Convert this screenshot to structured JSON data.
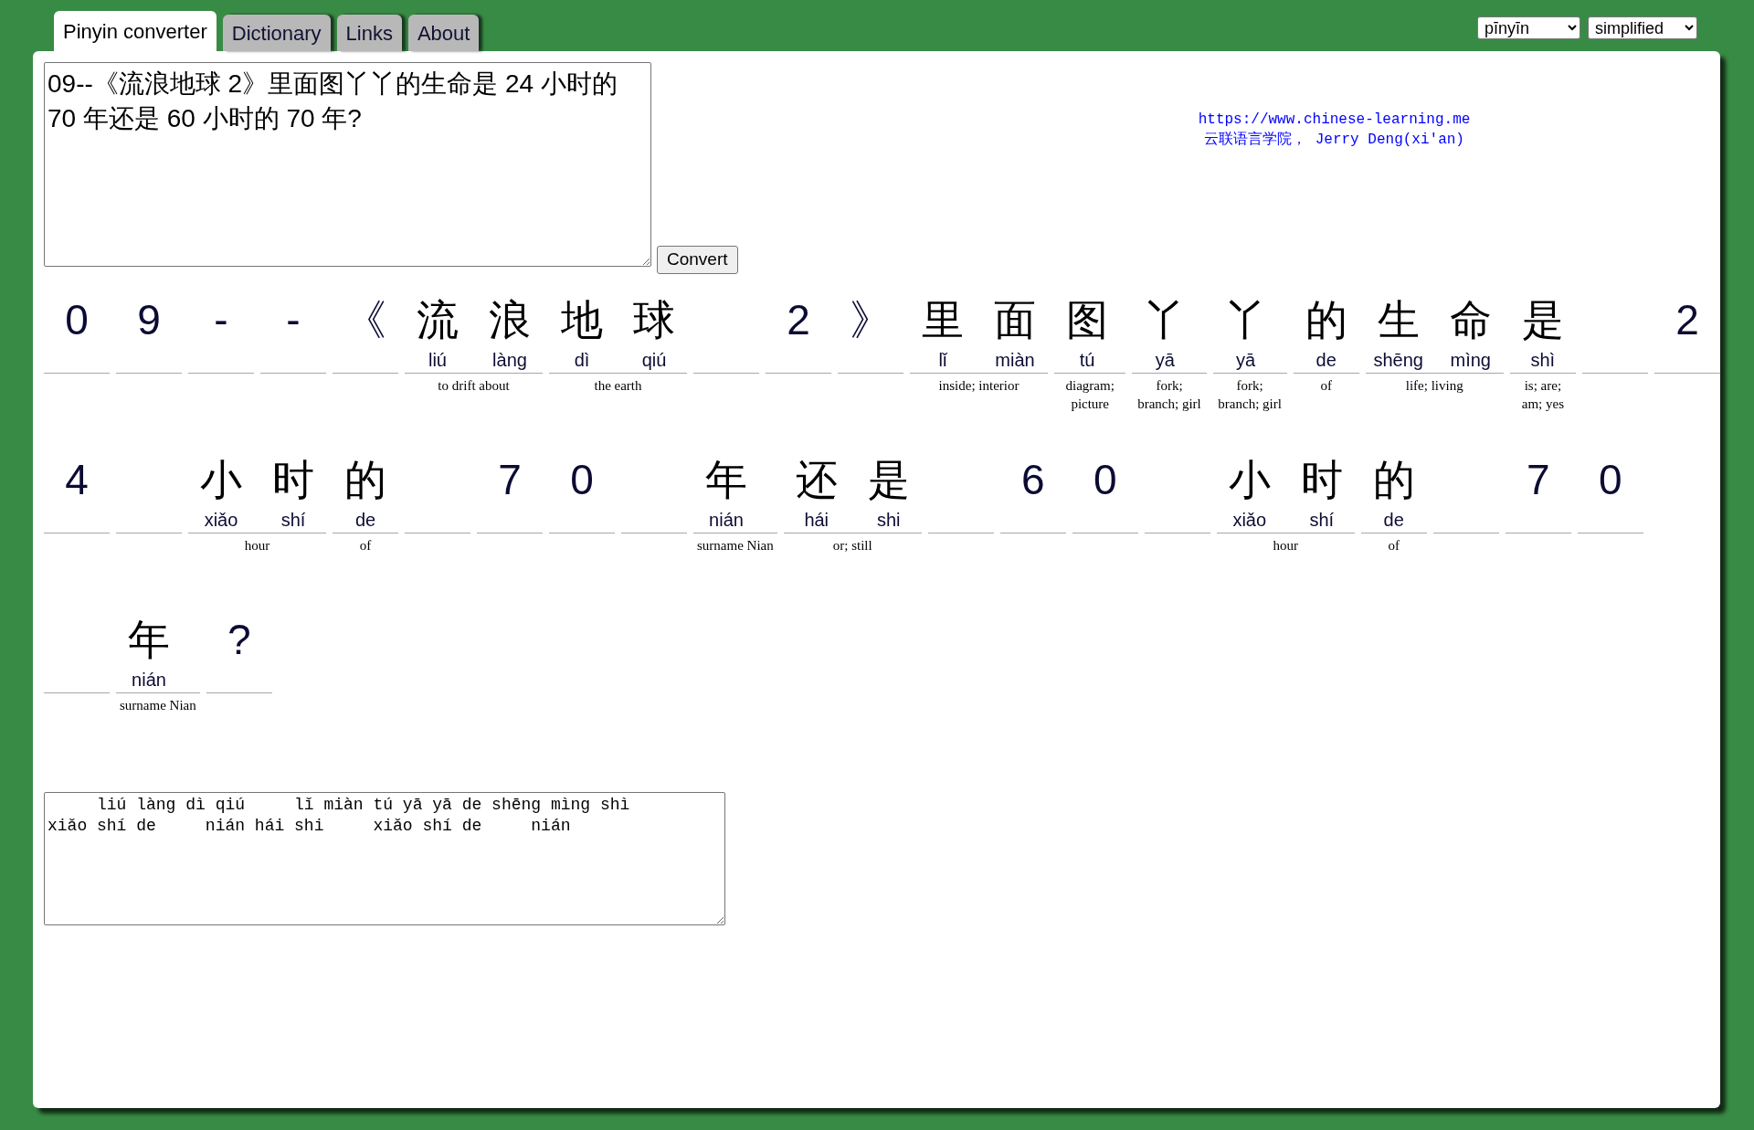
{
  "tabs": [
    {
      "label": "Pinyin converter",
      "selected": true
    },
    {
      "label": "Dictionary",
      "selected": false
    },
    {
      "label": "Links",
      "selected": false
    },
    {
      "label": "About",
      "selected": false
    }
  ],
  "selects": [
    {
      "value": "pīnyīn"
    },
    {
      "value": "simplified"
    }
  ],
  "input": {
    "value": "09--《流浪地球 2》里面图丫丫的生命是 24 小时的 70 年还是 60 小时的 70 年?"
  },
  "convert_button": "Convert",
  "credit": {
    "url": "https://www.chinese-learning.me",
    "author": "云联语言学院， Jerry Deng(xi'an)"
  },
  "rows": [
    [
      {
        "kind": "symbol",
        "text": "0"
      },
      {
        "kind": "symbol",
        "text": "9"
      },
      {
        "kind": "symbol",
        "text": "-"
      },
      {
        "kind": "symbol",
        "text": "-"
      },
      {
        "kind": "symbol",
        "text": "《"
      },
      {
        "kind": "word",
        "chars": [
          {
            "hanzi": "流",
            "pinyin": "liú"
          },
          {
            "hanzi": "浪",
            "pinyin": "làng"
          }
        ],
        "meaning": "to drift about"
      },
      {
        "kind": "word",
        "chars": [
          {
            "hanzi": "地",
            "pinyin": "dì"
          },
          {
            "hanzi": "球",
            "pinyin": "qiú"
          }
        ],
        "meaning": "the earth"
      },
      {
        "kind": "space"
      },
      {
        "kind": "symbol",
        "text": "2"
      },
      {
        "kind": "symbol",
        "text": "》"
      },
      {
        "kind": "word",
        "chars": [
          {
            "hanzi": "里",
            "pinyin": "lǐ"
          },
          {
            "hanzi": "面",
            "pinyin": "miàn"
          }
        ],
        "meaning": "inside; interior"
      },
      {
        "kind": "word",
        "chars": [
          {
            "hanzi": "图",
            "pinyin": "tú"
          }
        ],
        "meaning": "diagram; picture"
      },
      {
        "kind": "word",
        "chars": [
          {
            "hanzi": "丫",
            "pinyin": "yā"
          }
        ],
        "meaning": "fork; branch; girl"
      },
      {
        "kind": "word",
        "chars": [
          {
            "hanzi": "丫",
            "pinyin": "yā"
          }
        ],
        "meaning": "fork; branch; girl"
      },
      {
        "kind": "word",
        "chars": [
          {
            "hanzi": "的",
            "pinyin": "de"
          }
        ],
        "meaning": "of"
      },
      {
        "kind": "word",
        "chars": [
          {
            "hanzi": "生",
            "pinyin": "shēng"
          },
          {
            "hanzi": "命",
            "pinyin": "mìng"
          }
        ],
        "meaning": "life; living"
      },
      {
        "kind": "word",
        "chars": [
          {
            "hanzi": "是",
            "pinyin": "shì"
          }
        ],
        "meaning": "is; are; am; yes"
      },
      {
        "kind": "space"
      },
      {
        "kind": "symbol",
        "text": "2"
      }
    ],
    [
      {
        "kind": "symbol",
        "text": "4"
      },
      {
        "kind": "space"
      },
      {
        "kind": "word",
        "chars": [
          {
            "hanzi": "小",
            "pinyin": "xiǎo"
          },
          {
            "hanzi": "时",
            "pinyin": "shí"
          }
        ],
        "meaning": "hour"
      },
      {
        "kind": "word",
        "chars": [
          {
            "hanzi": "的",
            "pinyin": "de"
          }
        ],
        "meaning": "of"
      },
      {
        "kind": "space"
      },
      {
        "kind": "symbol",
        "text": "7"
      },
      {
        "kind": "symbol",
        "text": "0"
      },
      {
        "kind": "space"
      },
      {
        "kind": "word",
        "chars": [
          {
            "hanzi": "年",
            "pinyin": "nián"
          }
        ],
        "meaning": "surname Nian"
      },
      {
        "kind": "word",
        "chars": [
          {
            "hanzi": "还",
            "pinyin": "hái"
          },
          {
            "hanzi": "是",
            "pinyin": "shi"
          }
        ],
        "meaning": "or; still"
      },
      {
        "kind": "space"
      },
      {
        "kind": "symbol",
        "text": "6"
      },
      {
        "kind": "symbol",
        "text": "0"
      },
      {
        "kind": "space"
      },
      {
        "kind": "word",
        "chars": [
          {
            "hanzi": "小",
            "pinyin": "xiǎo"
          },
          {
            "hanzi": "时",
            "pinyin": "shí"
          }
        ],
        "meaning": "hour"
      },
      {
        "kind": "word",
        "chars": [
          {
            "hanzi": "的",
            "pinyin": "de"
          }
        ],
        "meaning": "of"
      },
      {
        "kind": "space"
      },
      {
        "kind": "symbol",
        "text": "7"
      },
      {
        "kind": "symbol",
        "text": "0"
      }
    ],
    [
      {
        "kind": "space"
      },
      {
        "kind": "word",
        "chars": [
          {
            "hanzi": "年",
            "pinyin": "nián"
          }
        ],
        "meaning": "surname Nian"
      },
      {
        "kind": "symbol",
        "text": "?"
      }
    ]
  ],
  "output": {
    "value": "     liú làng dì qiú     lǐ miàn tú yā yā de shēng mìng shì\nxiǎo shí de     nián hái shi     xiǎo shí de     nián"
  }
}
